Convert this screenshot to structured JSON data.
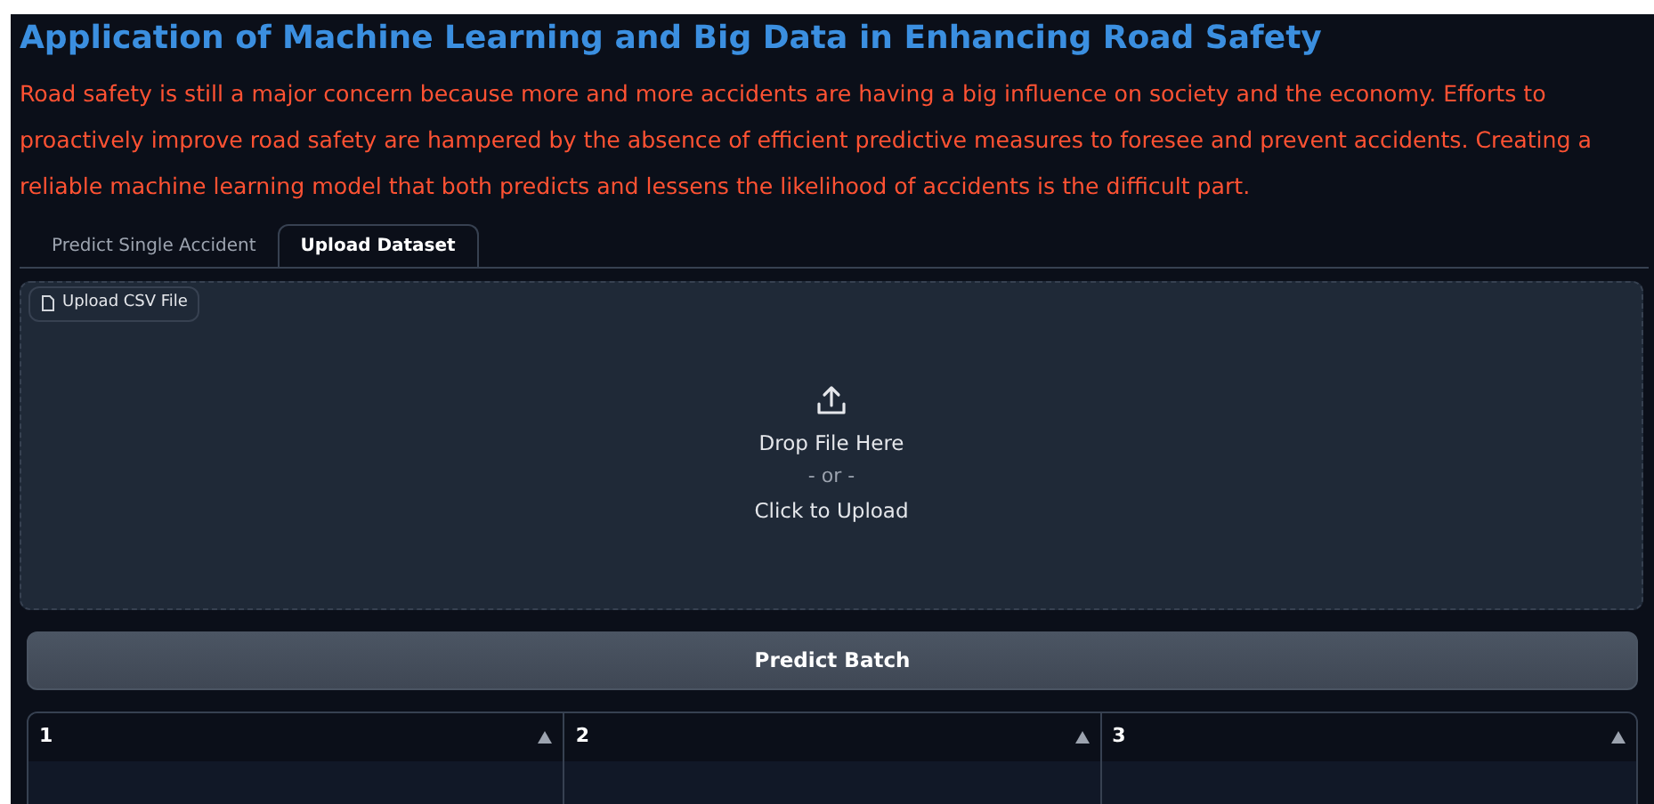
{
  "title": "Application of Machine Learning and Big Data in Enhancing Road Safety",
  "description": "Road safety is still a major concern because more and more accidents are having a big influence on society and the economy. Efforts to proactively improve road safety are hampered by the absence of efficient predictive measures to foresee and prevent accidents. Creating a reliable machine learning model that both predicts and lessens the likelihood of accidents is the difficult part.",
  "tabs": [
    {
      "label": "Predict Single Accident",
      "selected": false
    },
    {
      "label": "Upload Dataset",
      "selected": true
    }
  ],
  "upload": {
    "label": "Upload CSV File",
    "drop_text": "Drop File Here",
    "or_text": "- or -",
    "click_text": "Click to Upload"
  },
  "button": "Predict Batch",
  "table": {
    "columns": [
      "1",
      "2",
      "3"
    ]
  }
}
